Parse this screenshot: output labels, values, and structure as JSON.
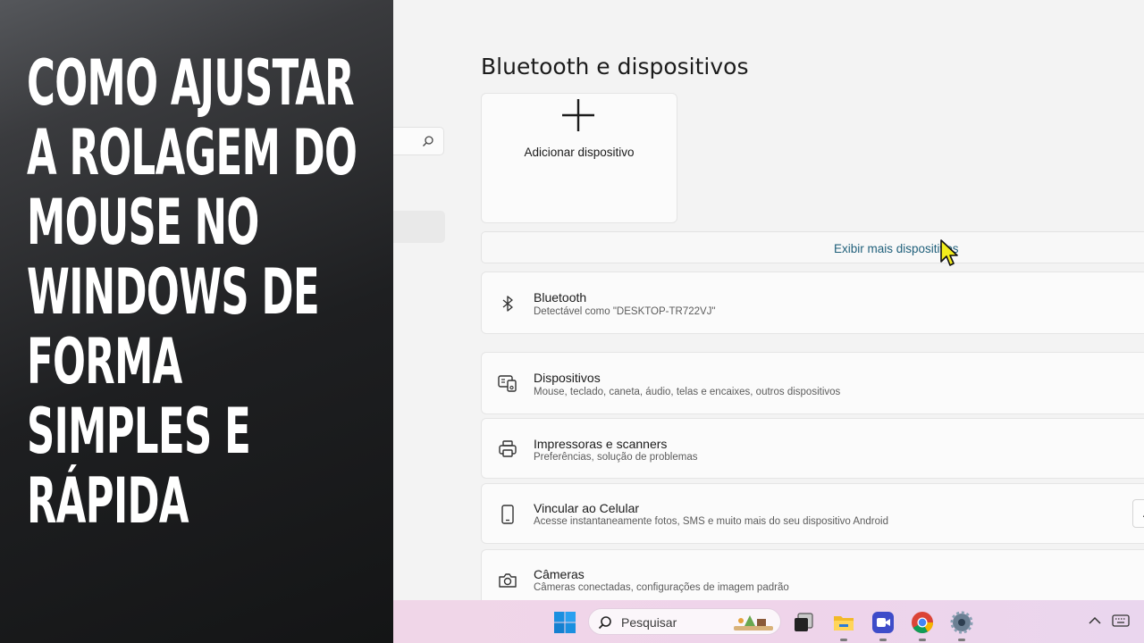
{
  "overlay": {
    "lines": [
      "COMO AJUSTAR",
      "A ROLAGEM DO",
      "MOUSE NO",
      "WINDOWS DE",
      "FORMA",
      "SIMPLES E",
      "RÁPIDA"
    ]
  },
  "settings": {
    "page_title": "Bluetooth e dispositivos",
    "add_device_label": "Adicionar dispositivo",
    "show_more_link": "Exibir mais dispositivos",
    "rows": [
      {
        "icon": "bluetooth-icon",
        "title": "Bluetooth",
        "subtitle": "Detectável como \"DESKTOP-TR722VJ\""
      },
      {
        "icon": "devices-icon",
        "title": "Dispositivos",
        "subtitle": "Mouse, teclado, caneta, áudio, telas e encaixes, outros dispositivos"
      },
      {
        "icon": "printer-icon",
        "title": "Impressoras e scanners",
        "subtitle": "Preferências, solução de problemas"
      },
      {
        "icon": "phone-icon",
        "title": "Vincular ao Celular",
        "subtitle": "Acesse instantaneamente fotos, SMS e muito mais do seu dispositivo Android",
        "button": "Ab"
      },
      {
        "icon": "camera-icon",
        "title": "Câmeras",
        "subtitle": "Câmeras conectadas, configurações de imagem padrão"
      }
    ]
  },
  "taskbar": {
    "search_placeholder": "Pesquisar",
    "apps": [
      "windows-start-icon",
      "task-view-icon",
      "file-explorer-icon",
      "meet-icon",
      "chrome-icon",
      "settings-gear-icon"
    ],
    "tray": [
      "chevron-up-icon",
      "keyboard-icon"
    ]
  },
  "colors": {
    "overlay_bg": "#1e1f21",
    "accent": "#1b8f7f",
    "link": "#1f5f7a",
    "taskbar": "#efd4ea"
  }
}
